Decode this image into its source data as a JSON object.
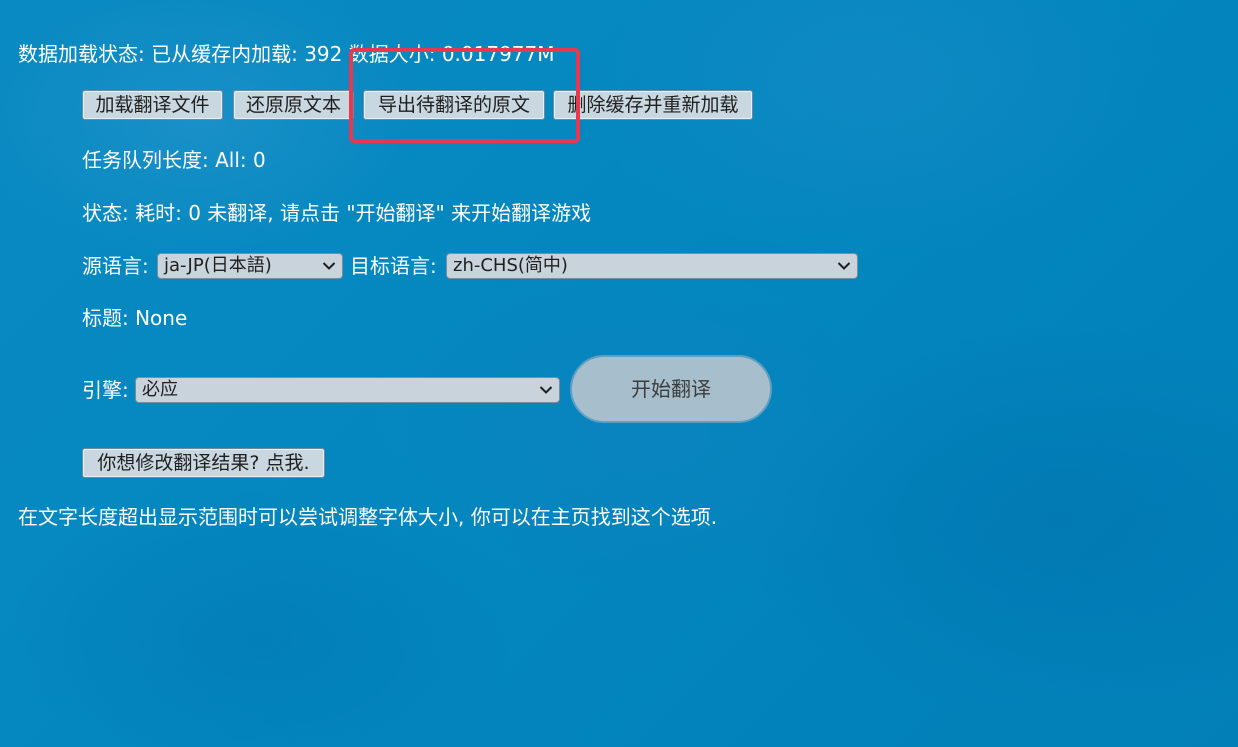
{
  "status_line": "数据加载状态: 已从缓存内加载: 392 数据大小: 0.017977M",
  "buttons": {
    "load_translation": "加载翻译文件",
    "restore_original": "还原原文本",
    "export_pending": "导出待翻译的原文",
    "clear_cache_reload": "删除缓存并重新加载",
    "modify_results": "你想修改翻译结果? 点我."
  },
  "queue_length": "任务队列长度: All: 0",
  "state_line": "状态: 耗时: 0 未翻译, 请点击 \"开始翻译\" 来开始翻译游戏",
  "source_language": {
    "label": "源语言:",
    "selected": "ja-JP(日本語)"
  },
  "target_language": {
    "label": "目标语言:",
    "selected": "zh-CHS(简中)"
  },
  "title_line": "标题: None",
  "engine": {
    "label": "引擎:",
    "selected": "必应"
  },
  "start_translate": "开始翻译",
  "hint_line": "在文字长度超出显示范围时可以尝试调整字体大小, 你可以在主页找到这个选项.",
  "colors": {
    "background": "#0384bd",
    "highlight_box": "#e8384f",
    "button_bg": "#c9d7e1"
  },
  "icons": {
    "dropdown": "chevron-down-icon"
  }
}
